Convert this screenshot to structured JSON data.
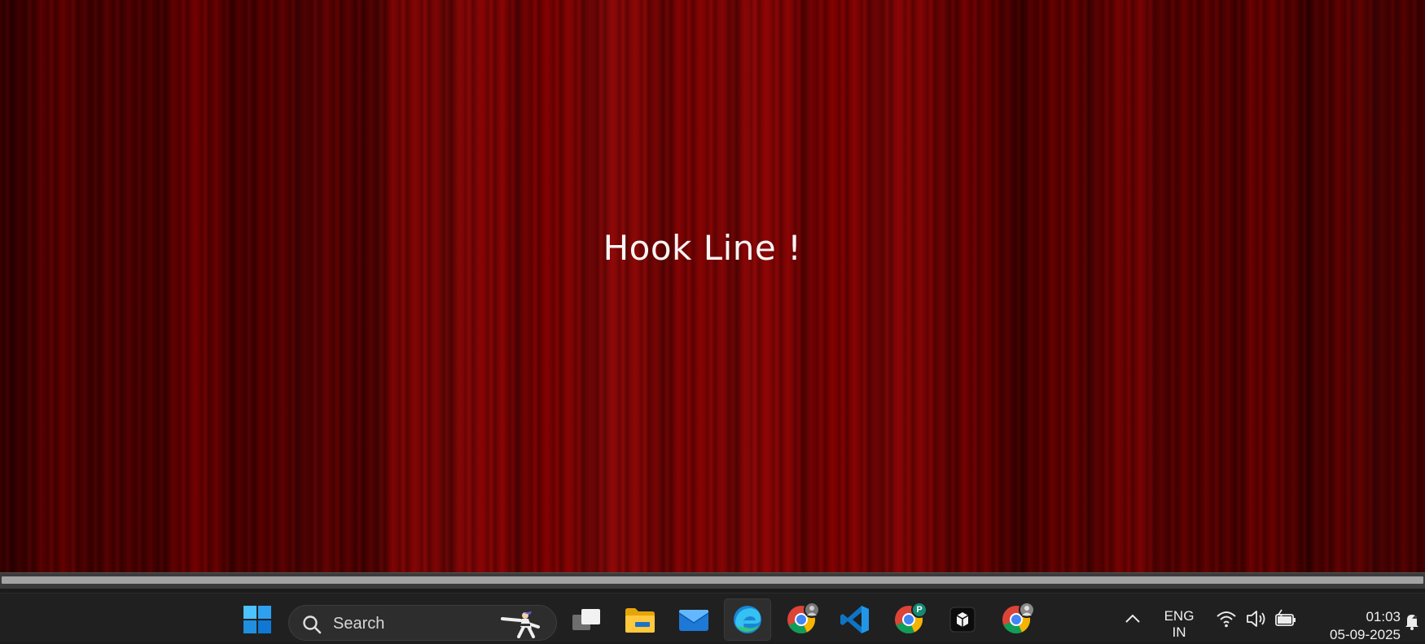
{
  "stage": {
    "title": "Hook Line !"
  },
  "taskbar": {
    "search": {
      "label": "Search"
    },
    "apps": [
      {
        "name": "task-view-icon"
      },
      {
        "name": "file-explorer-icon"
      },
      {
        "name": "mail-icon"
      },
      {
        "name": "edge-icon"
      },
      {
        "name": "chrome-icon"
      },
      {
        "name": "vscode-icon"
      },
      {
        "name": "chrome-icon",
        "badge": "P"
      },
      {
        "name": "app-icon"
      },
      {
        "name": "chrome-icon"
      }
    ],
    "tray": {
      "language": "ENG",
      "region": "IN",
      "time": "01:03",
      "date": "05-09-2025"
    }
  },
  "colors": {
    "curtain": "#7a0000",
    "taskbar": "#202020",
    "windows_blue": "#2da0f0"
  }
}
